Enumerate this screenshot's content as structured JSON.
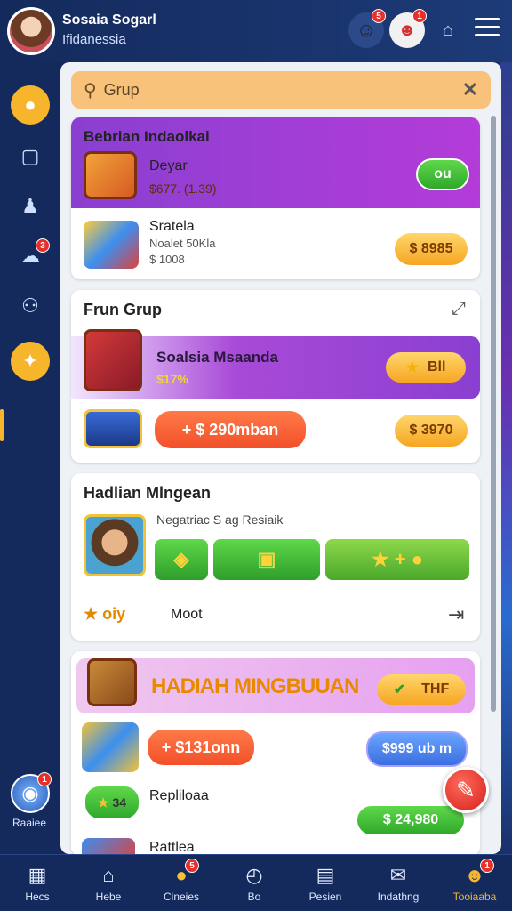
{
  "header": {
    "user_name": "Sosaia Sogarl",
    "user_location": "Ifidanessia",
    "notif_badge_1": "5",
    "notif_badge_2": "1"
  },
  "sidebar": {
    "chat_badge": "3",
    "profile_badge": "1",
    "bottom_label": "Raaiee"
  },
  "search": {
    "label": "Grup"
  },
  "section1": {
    "title": "Bebrian Indaolkai",
    "item1_name": "Deyar",
    "item1_price": "$677. (1.39)",
    "item1_button": "ou",
    "item2_name": "Sratela",
    "item2_sub": "Noalet 50Kla",
    "item2_amount": "$ 1008",
    "item2_price": "$ 8985"
  },
  "section2": {
    "title": "Frun Grup",
    "banner_name": "Soalsia Msaanda",
    "banner_price": "$17%",
    "banner_button": "Bll",
    "deal_amount": "+ $ 290mban",
    "deal_price": "$ 3970"
  },
  "section3": {
    "title": "Hadlian Mlngean",
    "subtitle": "Negatriac S ag Resiaik",
    "footer_left": "oiy",
    "footer_label": "Moot"
  },
  "section4": {
    "banner_title": "HADIAH MINGBUUAN",
    "banner_button": "THF",
    "deal_amount": "+ $131onn",
    "deal_price": "$999 ub m",
    "item_badge": "34",
    "item_name": "Repliloaa",
    "item_price": "$ 24,980",
    "item2_name": "Rattlea"
  },
  "bottom_nav": [
    {
      "label": "Hecs"
    },
    {
      "label": "Hebe"
    },
    {
      "label": "Cineies"
    },
    {
      "label": "Bo"
    },
    {
      "label": "Pesien"
    },
    {
      "label": "Indathng"
    },
    {
      "label": "Tooiaaba"
    }
  ],
  "bottom_nav_badges": {
    "third": "5",
    "last": "1"
  },
  "colors": {
    "navy": "#142a5c",
    "accent_orange": "#f7b52c",
    "purple": "#8a3fd1",
    "green": "#3bb82f",
    "red": "#e8302b"
  }
}
